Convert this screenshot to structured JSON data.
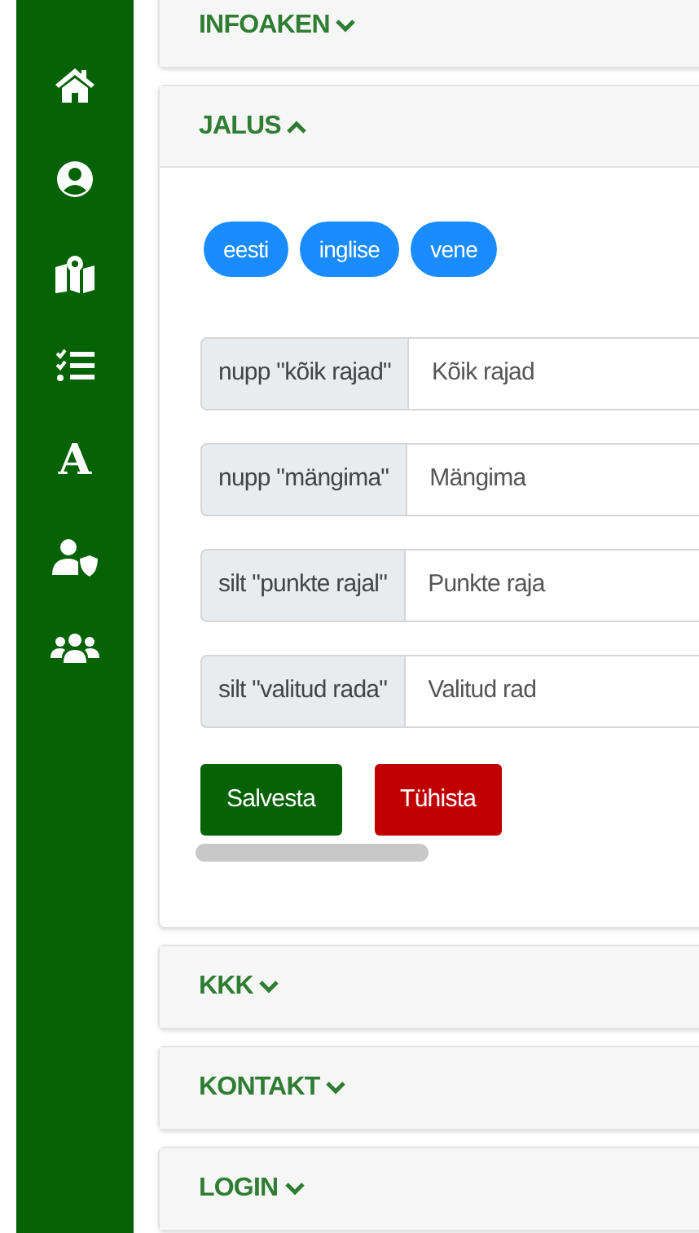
{
  "sidebar": {
    "items": [
      {
        "kind": "home"
      },
      {
        "kind": "user"
      },
      {
        "kind": "map"
      },
      {
        "kind": "list"
      },
      {
        "kind": "letter",
        "label": "A"
      },
      {
        "kind": "shield"
      },
      {
        "kind": "users"
      }
    ]
  },
  "panels": [
    {
      "title": "INFOAKEN",
      "expanded": false
    },
    {
      "title": "JALUS",
      "expanded": true,
      "languages": [
        {
          "label": "eesti"
        },
        {
          "label": "inglise"
        },
        {
          "label": "vene"
        }
      ],
      "fields": [
        {
          "label": "nupp \"kõik rajad\"",
          "value": "Kõik rajad"
        },
        {
          "label": "nupp \"mängima\"",
          "value": "Mängima"
        },
        {
          "label": "silt \"punkte rajal\"",
          "value": "Punkte raja"
        },
        {
          "label": "silt \"valitud rada\"",
          "value": "Valitud rad"
        }
      ],
      "buttons": [
        {
          "label": "Salvesta",
          "kind": "save"
        },
        {
          "label": "Tühista",
          "kind": "cancel"
        }
      ]
    },
    {
      "title": "KKK",
      "expanded": false
    },
    {
      "title": "KONTAKT",
      "expanded": false
    },
    {
      "title": "LOGIN",
      "expanded": false
    }
  ]
}
